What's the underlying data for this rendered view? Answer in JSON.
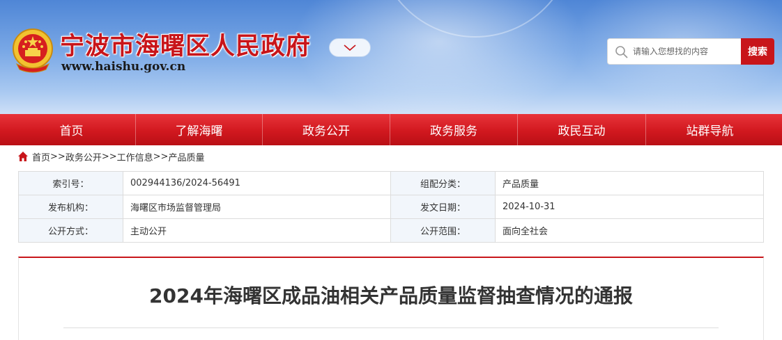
{
  "header": {
    "site_title": "宁波市海曙区人民政府",
    "site_url": "www.haishu.gov.cn",
    "search": {
      "placeholder": "请输入您想找的内容",
      "button_label": "搜索"
    }
  },
  "nav": {
    "items": [
      "首页",
      "了解海曙",
      "政务公开",
      "政务服务",
      "政民互动",
      "站群导航"
    ]
  },
  "breadcrumb": {
    "path": [
      "首页",
      ">>",
      "政务公开",
      ">>",
      "工作信息",
      ">>",
      "产品质量"
    ]
  },
  "meta": {
    "rows": [
      [
        {
          "label": "索引号：",
          "value": "002944136/2024-56491"
        },
        {
          "label": "组配分类：",
          "value": "产品质量"
        }
      ],
      [
        {
          "label": "发布机构：",
          "value": "海曙区市场监督管理局"
        },
        {
          "label": "发文日期：",
          "value": "2024-10-31"
        }
      ],
      [
        {
          "label": "公开方式：",
          "value": "主动公开"
        },
        {
          "label": "公开范围：",
          "value": "面向全社会"
        }
      ]
    ]
  },
  "article": {
    "title": "2024年海曙区成品油相关产品质量监督抽查情况的通报"
  },
  "colors": {
    "brand_red": "#c8151a",
    "header_blue": "#4f86d6"
  },
  "icons": [
    "national-emblem-icon",
    "chevron-down-icon",
    "search-icon",
    "home-icon"
  ]
}
